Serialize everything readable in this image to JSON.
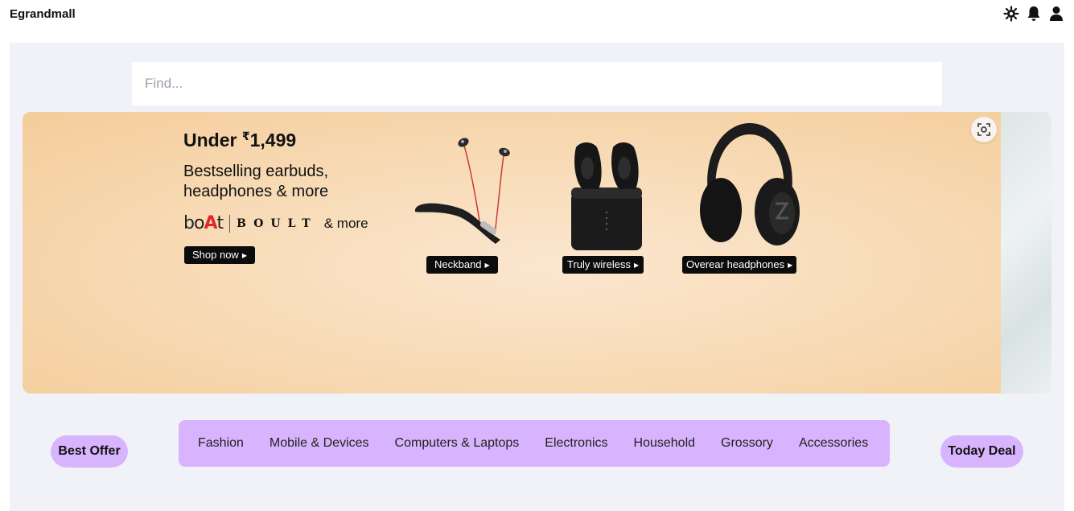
{
  "header": {
    "brand": "Egrandmall",
    "icons": [
      "sun-icon",
      "bell-icon",
      "user-icon"
    ]
  },
  "search": {
    "placeholder": "Find..."
  },
  "banner": {
    "title_prefix": "Under ",
    "currency": "₹",
    "price": "1,499",
    "subtitle": "Bestselling earbuds, headphones & more",
    "brand_boat_a": "bo",
    "brand_boat_b": "A",
    "brand_boat_c": "t",
    "brand_boult": "BOULT",
    "brand_more": "& more",
    "shop_now": "Shop now",
    "products": [
      {
        "label": "Neckband"
      },
      {
        "label": "Truly wireless"
      },
      {
        "label": "Overear headphones"
      }
    ]
  },
  "nav": {
    "best_offer": "Best Offer",
    "today_deal": "Today Deal",
    "categories": [
      "Fashion",
      "Mobile & Devices",
      "Computers & Laptops",
      "Electronics",
      "Household",
      "Grossory",
      "Accessories"
    ]
  },
  "colors": {
    "accent": "#d8b4fe",
    "page_bg": "#f0f2f7",
    "pill_bg": "#0c0c0c",
    "boat_red": "#e0262b"
  }
}
